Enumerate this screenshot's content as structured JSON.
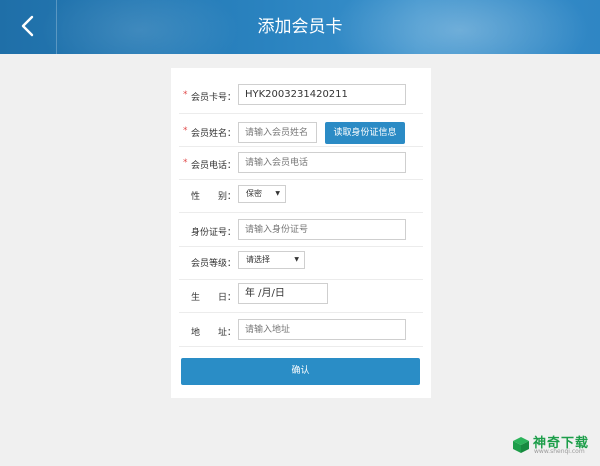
{
  "header": {
    "title": "添加会员卡",
    "back_icon": "chevron-left-icon"
  },
  "form": {
    "card_no": {
      "label": "会员卡号：",
      "required": "*",
      "value": "HYK2003231420211"
    },
    "name": {
      "label": "会员姓名：",
      "required": "*",
      "placeholder": "请输入会员姓名",
      "read_id_button": "读取身份证信息"
    },
    "phone": {
      "label": "会员电话：",
      "required": "*",
      "placeholder": "请输入会员电话"
    },
    "gender": {
      "label": "性　　别：",
      "selected": "保密"
    },
    "id_number": {
      "label": "身份证号：",
      "placeholder": "请输入身份证号"
    },
    "level": {
      "label": "会员等级：",
      "selected": "请选择"
    },
    "birthday": {
      "label": "生　　日：",
      "value": "年 /月/日"
    },
    "address": {
      "label": "地　　址：",
      "placeholder": "请输入地址"
    },
    "confirm_label": "确认"
  },
  "watermark": {
    "name": "神奇下载",
    "url": "www.shenqi.com",
    "color": "#1d9e4a"
  },
  "colors": {
    "header": "#2a83c0",
    "accent": "#2a8dc6",
    "required": "#e14b4b",
    "background": "#f0f0f0"
  }
}
